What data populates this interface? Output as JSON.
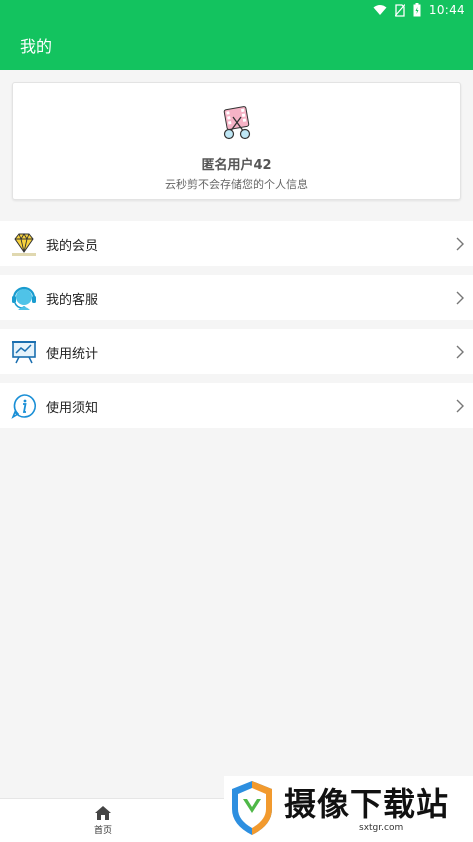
{
  "status_bar": {
    "time": "10:44"
  },
  "app_bar": {
    "title": "我的"
  },
  "profile": {
    "username": "匿名用户42",
    "privacy_note": "云秒剪不会存储您的个人信息"
  },
  "menu": {
    "items": [
      {
        "label": "我的会员",
        "icon": "diamond-icon"
      },
      {
        "label": "我的客服",
        "icon": "headset-icon"
      },
      {
        "label": "使用统计",
        "icon": "chart-board-icon"
      },
      {
        "label": "使用须知",
        "icon": "info-icon"
      }
    ]
  },
  "bottom_nav": {
    "home_label": "首页"
  },
  "watermark": {
    "text": "摄像下载站",
    "domain": "sxtgr.com"
  },
  "colors": {
    "accent": "#13c35f",
    "background": "#f5f5f5"
  }
}
